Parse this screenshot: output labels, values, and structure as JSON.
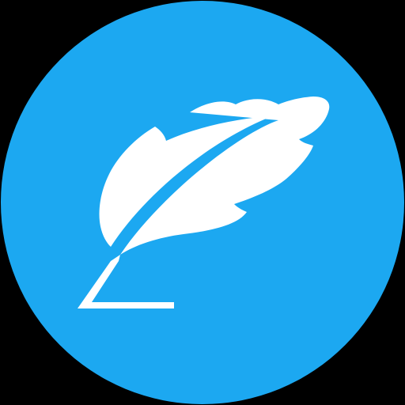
{
  "icon": {
    "name": "feather-quill-icon",
    "background_color": "#000000",
    "circle_color": "#1ca8f1",
    "feather_color": "#ffffff"
  }
}
